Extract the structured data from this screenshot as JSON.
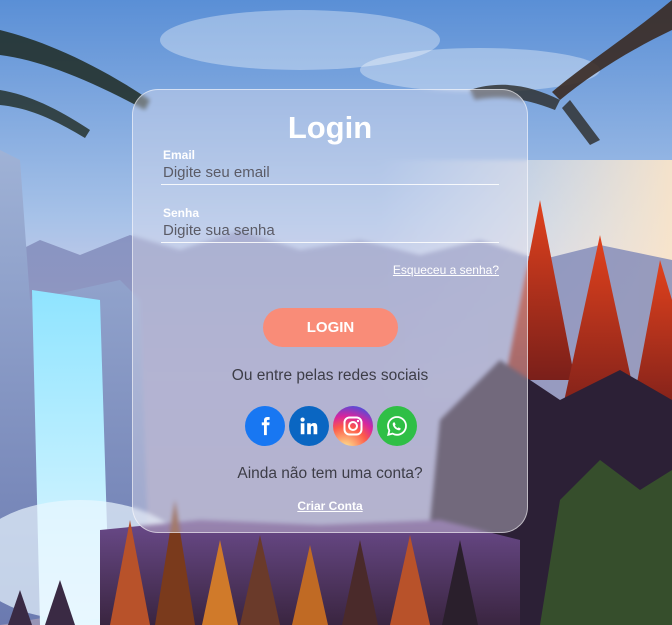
{
  "login": {
    "title": "Login",
    "email_label": "Email",
    "email_placeholder": "Digite seu email",
    "password_label": "Senha",
    "password_placeholder": "Digite sua senha",
    "forgot_link": "Esqueceu a senha?",
    "login_button": "LOGIN",
    "social_text": "Ou entre pelas redes sociais",
    "social_icons": [
      "facebook-icon",
      "linkedin-icon",
      "instagram-icon",
      "whatsapp-icon"
    ],
    "no_account_text": "Ainda não tem uma conta?",
    "create_link": "Criar Conta"
  },
  "colors": {
    "button": "#f98c78",
    "facebook": "#1877f2",
    "linkedin": "#0a66c2",
    "whatsapp": "#2fbf46"
  }
}
